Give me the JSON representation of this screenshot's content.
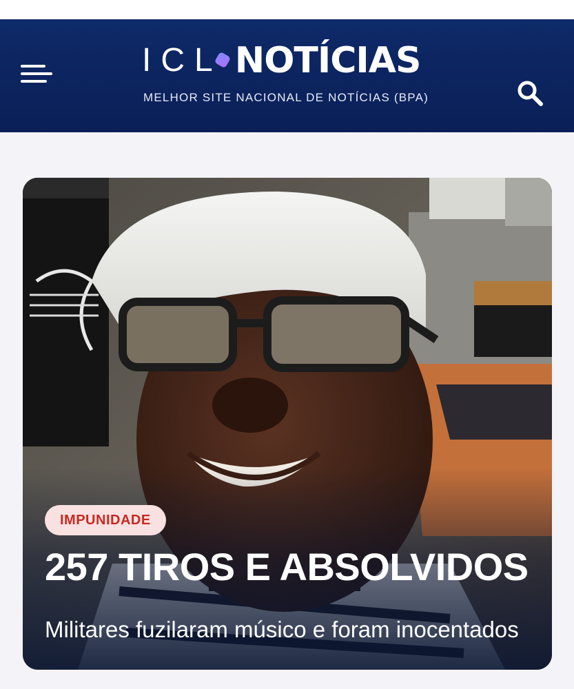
{
  "header": {
    "logo_icl": "ICL",
    "logo_noticias": "NOTÍCIAS",
    "tagline": "MELHOR SITE NACIONAL DE NOTÍCIAS (BPA)",
    "menu_icon": "hamburger-menu-icon",
    "search_icon": "search-icon",
    "background_color": "#0b2360"
  },
  "featured_article": {
    "category": "IMPUNIDADE",
    "headline": "257 TIROS E ABSOLVIDOS",
    "subtitle": "Militares fuzilaram músico e foram inocentados",
    "badge_bg_color": "#f9e1e1",
    "badge_text_color": "#c82a22"
  }
}
